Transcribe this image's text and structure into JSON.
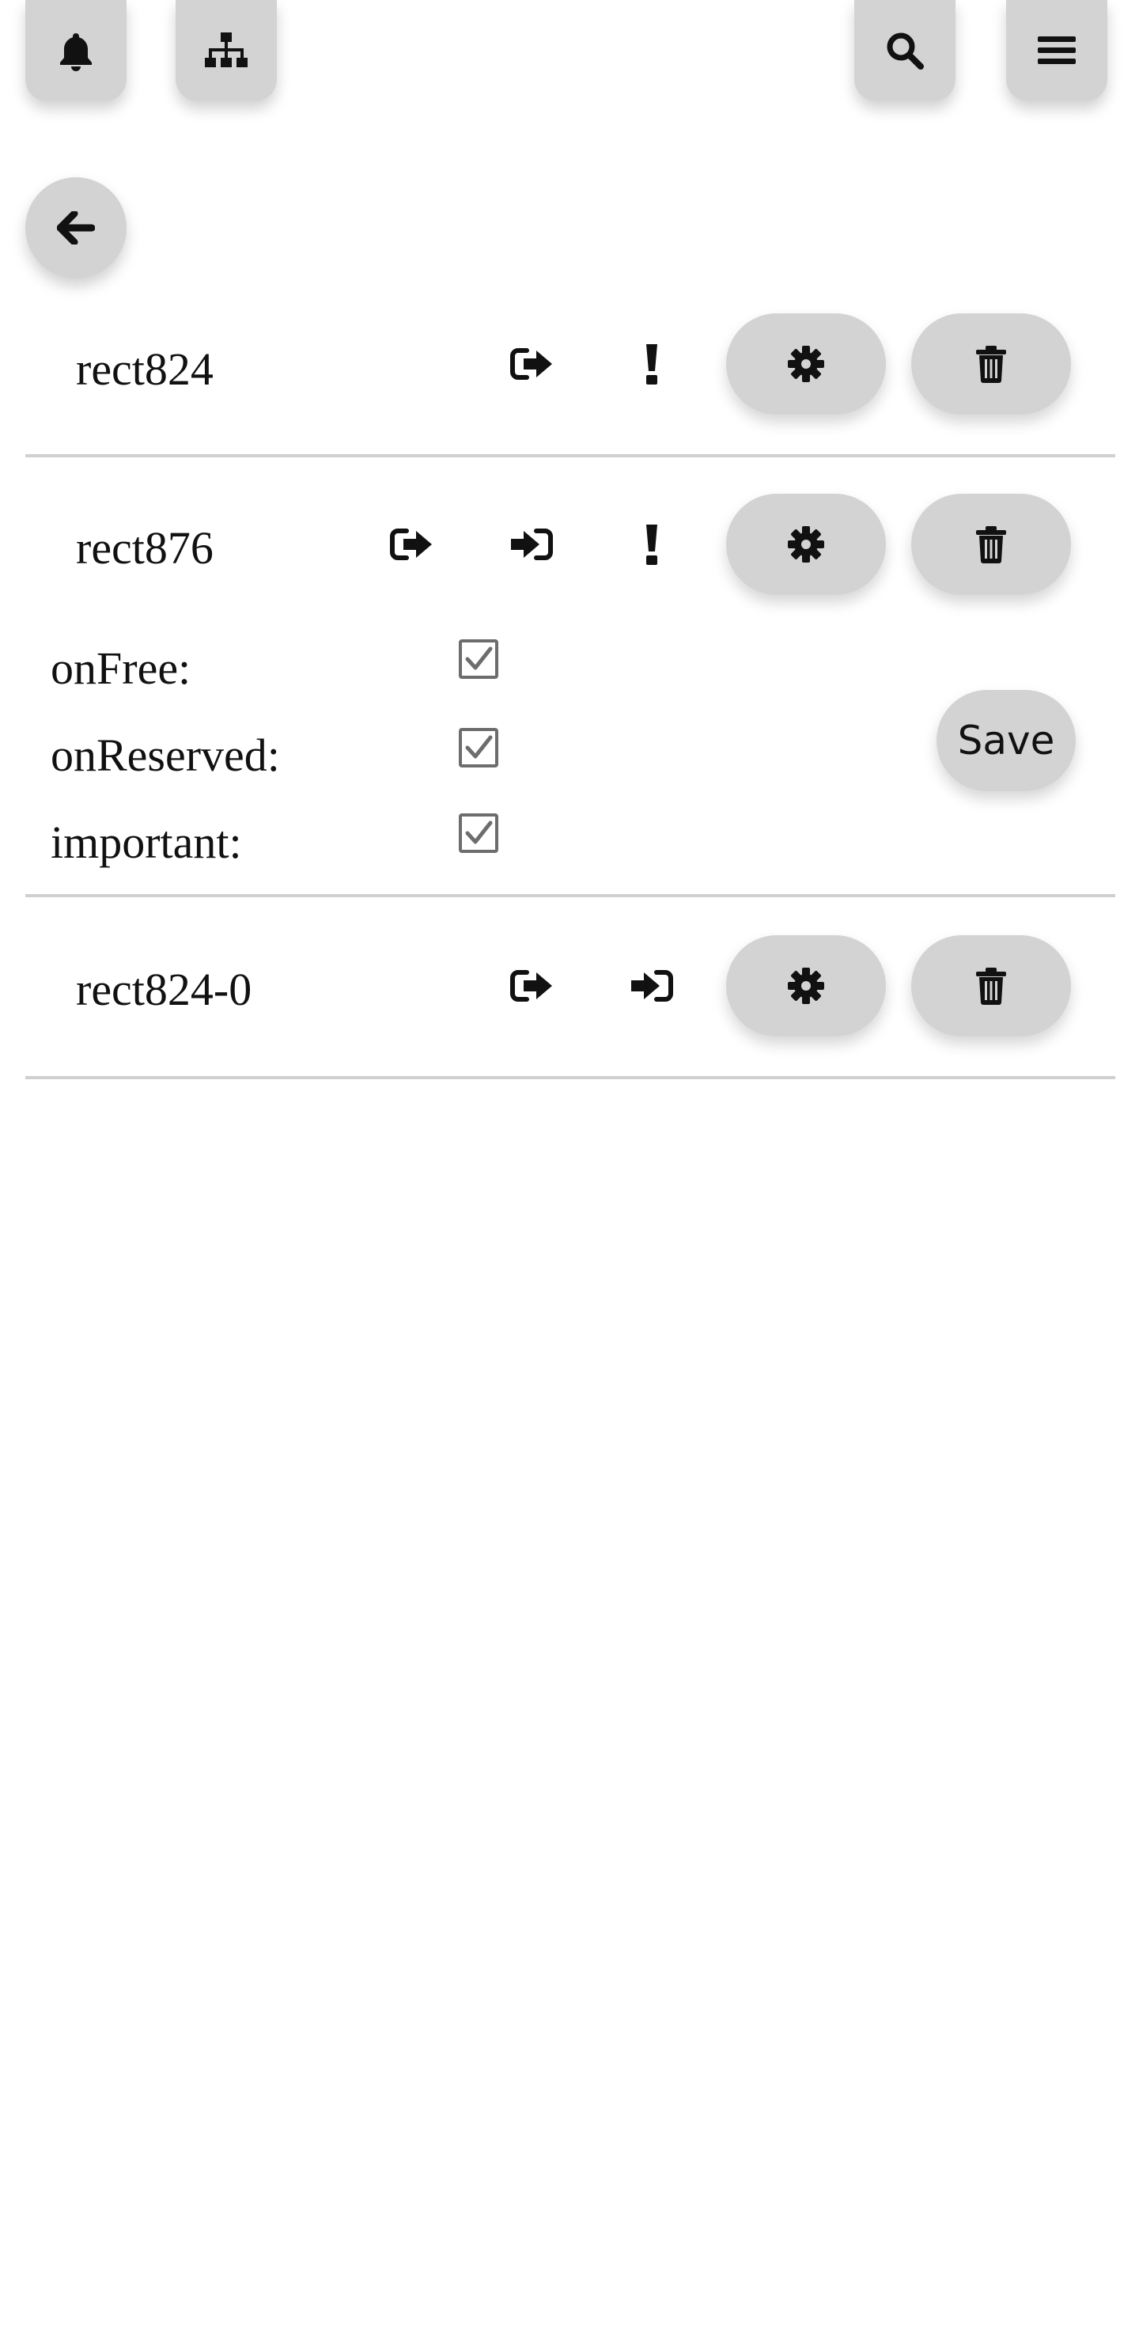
{
  "toolbar": {
    "notifications_icon": "bell-icon",
    "structure_icon": "sitemap-icon",
    "search_icon": "search-icon",
    "menu_icon": "hamburger-menu-icon"
  },
  "navigation": {
    "back_icon": "arrow-left-icon"
  },
  "items": [
    {
      "name": "rect824",
      "icons": [
        "sign-out-icon",
        "exclamation-icon"
      ],
      "actions": [
        "gear-icon",
        "trash-icon"
      ]
    },
    {
      "name": "rect876",
      "icons": [
        "sign-out-icon",
        "sign-in-icon",
        "exclamation-icon"
      ],
      "actions": [
        "gear-icon",
        "trash-icon"
      ],
      "expanded": true,
      "options": [
        {
          "label": "onFree:",
          "checked": true
        },
        {
          "label": "onReserved:",
          "checked": true
        },
        {
          "label": "important:",
          "checked": true
        }
      ],
      "save_label": "Save"
    },
    {
      "name": "rect824-0",
      "icons": [
        "sign-out-icon",
        "sign-in-icon"
      ],
      "actions": [
        "gear-icon",
        "trash-icon"
      ]
    }
  ],
  "colors": {
    "button_bg": "#d3d3d3",
    "divider": "#d0d0d0",
    "checkbox_border": "#6d6d6d",
    "icon": "#111111"
  }
}
